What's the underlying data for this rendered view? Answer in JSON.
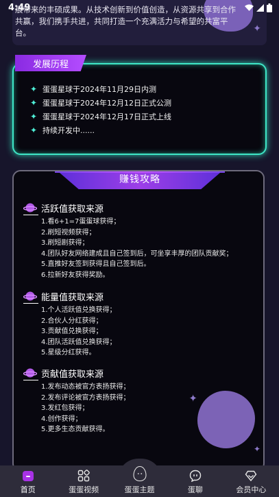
{
  "status_bar": {
    "time": "4:49"
  },
  "intro": {
    "text": "展带来的丰硕成果。从技术创新到价值创造，从资源共享到合作共赢，我们携手共进，共同打造一个充满活力与希望的共富平台。"
  },
  "history": {
    "title": "发展历程",
    "items": [
      "蛋蛋星球于2024年11月29日内测",
      "蛋蛋星球于2024年12月12日正式公测",
      "蛋蛋星球于2024年12月17日正式上线",
      "持续开发中......"
    ]
  },
  "earn": {
    "title": "赚钱攻略",
    "sections": [
      {
        "title": "活跃值获取来源",
        "items": [
          "1.看6+1=7蛋蛋球获得；",
          "2.刷短视频获得；",
          "3.刷短剧获得；",
          "4.团队好友网络建成且自己签到后，可坐享丰厚的团队贡献奖；",
          "5.直推好友签到获得且自己签到后。",
          "6.拉新好友获得奖励。"
        ]
      },
      {
        "title": "能量值获取来源",
        "items": [
          "1.个人活跃值兑换获得；",
          "2.合伙人分红获得；",
          "3.贡献值兑换获得；",
          "4.团队活跃值兑换获得；",
          "5.星级分红获得。"
        ]
      },
      {
        "title": "贡献值获取来源",
        "items": [
          "1.发布动态被官方表扬获得；",
          "2.发布评论被官方表扬获得；",
          "3.发红包获得；",
          "4.创作获得；",
          "5.更多生态贡献获得。"
        ]
      }
    ]
  },
  "nav": {
    "items": [
      {
        "label": "首页",
        "icon": "home-icon"
      },
      {
        "label": "蛋蛋视频",
        "icon": "grid-icon"
      },
      {
        "label": "蛋蛋主题",
        "icon": "egg-icon"
      },
      {
        "label": "蛋聊",
        "icon": "chat-icon"
      },
      {
        "label": "会员中心",
        "icon": "diamond-icon"
      }
    ]
  },
  "colors": {
    "background": "#17152b",
    "history_border": "#3ee6c6",
    "accent_purple": "#9d3fe8",
    "planet": "#7c63b6"
  }
}
